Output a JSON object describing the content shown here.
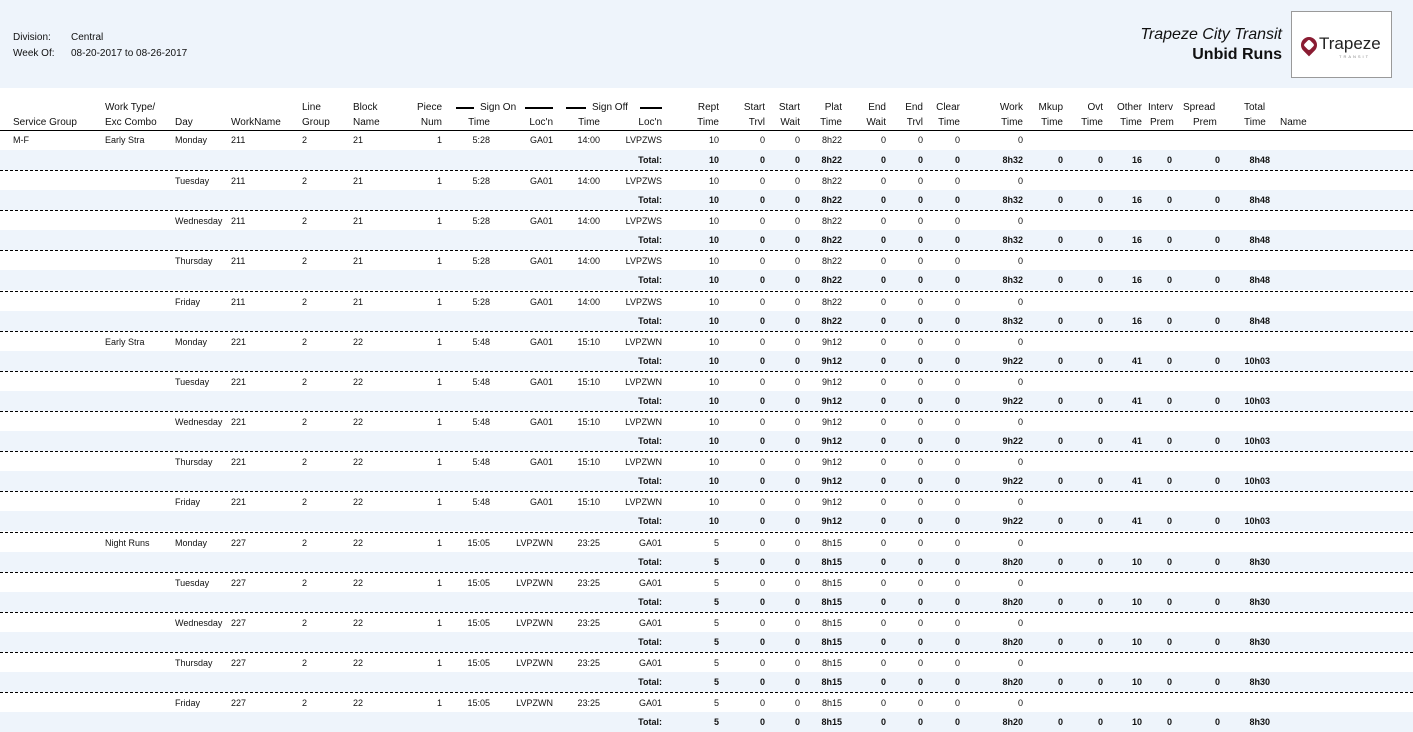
{
  "header": {
    "division_label": "Division:",
    "division_value": "Central",
    "week_label": "Week Of:",
    "week_value": "08-20-2017 to 08-26-2017",
    "company": "Trapeze City Transit",
    "report_title": "Unbid Runs",
    "logo_text": "Trapeze",
    "logo_sub": "TRANSIT"
  },
  "columns": {
    "service_group": "Service Group",
    "work_type_1": "Work Type/",
    "work_type_2": "Exc Combo",
    "day": "Day",
    "workname": "WorkName",
    "line_1": "Line",
    "line_2": "Group",
    "block_1": "Block",
    "block_2": "Name",
    "piece_1": "Piece",
    "piece_2": "Num",
    "sign_on": "Sign On",
    "sign_on_time": "Time",
    "sign_on_loc": "Loc'n",
    "sign_off": "Sign Off",
    "sign_off_time": "Time",
    "sign_off_loc": "Loc'n",
    "rept_1": "Rept",
    "rept_2": "Time",
    "start_trvl_1": "Start",
    "start_trvl_2": "Trvl",
    "start_wait_1": "Start",
    "start_wait_2": "Wait",
    "plat_1": "Plat",
    "plat_2": "Time",
    "end_wait_1": "End",
    "end_wait_2": "Wait",
    "end_trvl_1": "End",
    "end_trvl_2": "Trvl",
    "clear_1": "Clear",
    "clear_2": "Time",
    "work_1": "Work",
    "work_2": "Time",
    "mkup_1": "Mkup",
    "mkup_2": "Time",
    "ovt_1": "Ovt",
    "ovt_2": "Time",
    "other_1": "Other",
    "other_2": "Time",
    "interv_1": "Interv",
    "interv_2": "Prem",
    "spread_1": "Spread",
    "spread_2": "Prem",
    "total_1": "Total",
    "total_2": "Time",
    "name": "Name"
  },
  "rows": [
    {
      "sg": "M-F",
      "wt": "Early Stra",
      "day": "Monday",
      "wn": "211",
      "lg": "2",
      "bn": "21",
      "pn": "1",
      "on_t": "5:28",
      "on_l": "GA01",
      "off_t": "14:00",
      "off_l": "LVPZWS",
      "rept": "10",
      "st": "0",
      "sw": "0",
      "plat": "8h22",
      "ew": "0",
      "et": "0",
      "clr": "0",
      "work": "0",
      "tot": {
        "label": "Total:",
        "rept": "10",
        "st": "0",
        "sw": "0",
        "plat": "8h22",
        "ew": "0",
        "et": "0",
        "clr": "0",
        "work": "8h32",
        "mkup": "0",
        "ovt": "0",
        "other": "16",
        "interv": "0",
        "spread": "0",
        "total": "8h48"
      }
    },
    {
      "sg": "",
      "wt": "",
      "day": "Tuesday",
      "wn": "211",
      "lg": "2",
      "bn": "21",
      "pn": "1",
      "on_t": "5:28",
      "on_l": "GA01",
      "off_t": "14:00",
      "off_l": "LVPZWS",
      "rept": "10",
      "st": "0",
      "sw": "0",
      "plat": "8h22",
      "ew": "0",
      "et": "0",
      "clr": "0",
      "work": "0",
      "tot": {
        "label": "Total:",
        "rept": "10",
        "st": "0",
        "sw": "0",
        "plat": "8h22",
        "ew": "0",
        "et": "0",
        "clr": "0",
        "work": "8h32",
        "mkup": "0",
        "ovt": "0",
        "other": "16",
        "interv": "0",
        "spread": "0",
        "total": "8h48"
      }
    },
    {
      "sg": "",
      "wt": "",
      "day": "Wednesday",
      "wn": "211",
      "lg": "2",
      "bn": "21",
      "pn": "1",
      "on_t": "5:28",
      "on_l": "GA01",
      "off_t": "14:00",
      "off_l": "LVPZWS",
      "rept": "10",
      "st": "0",
      "sw": "0",
      "plat": "8h22",
      "ew": "0",
      "et": "0",
      "clr": "0",
      "work": "0",
      "tot": {
        "label": "Total:",
        "rept": "10",
        "st": "0",
        "sw": "0",
        "plat": "8h22",
        "ew": "0",
        "et": "0",
        "clr": "0",
        "work": "8h32",
        "mkup": "0",
        "ovt": "0",
        "other": "16",
        "interv": "0",
        "spread": "0",
        "total": "8h48"
      }
    },
    {
      "sg": "",
      "wt": "",
      "day": "Thursday",
      "wn": "211",
      "lg": "2",
      "bn": "21",
      "pn": "1",
      "on_t": "5:28",
      "on_l": "GA01",
      "off_t": "14:00",
      "off_l": "LVPZWS",
      "rept": "10",
      "st": "0",
      "sw": "0",
      "plat": "8h22",
      "ew": "0",
      "et": "0",
      "clr": "0",
      "work": "0",
      "tot": {
        "label": "Total:",
        "rept": "10",
        "st": "0",
        "sw": "0",
        "plat": "8h22",
        "ew": "0",
        "et": "0",
        "clr": "0",
        "work": "8h32",
        "mkup": "0",
        "ovt": "0",
        "other": "16",
        "interv": "0",
        "spread": "0",
        "total": "8h48"
      }
    },
    {
      "sg": "",
      "wt": "",
      "day": "Friday",
      "wn": "211",
      "lg": "2",
      "bn": "21",
      "pn": "1",
      "on_t": "5:28",
      "on_l": "GA01",
      "off_t": "14:00",
      "off_l": "LVPZWS",
      "rept": "10",
      "st": "0",
      "sw": "0",
      "plat": "8h22",
      "ew": "0",
      "et": "0",
      "clr": "0",
      "work": "0",
      "tot": {
        "label": "Total:",
        "rept": "10",
        "st": "0",
        "sw": "0",
        "plat": "8h22",
        "ew": "0",
        "et": "0",
        "clr": "0",
        "work": "8h32",
        "mkup": "0",
        "ovt": "0",
        "other": "16",
        "interv": "0",
        "spread": "0",
        "total": "8h48"
      }
    },
    {
      "sg": "",
      "wt": "Early Stra",
      "day": "Monday",
      "wn": "221",
      "lg": "2",
      "bn": "22",
      "pn": "1",
      "on_t": "5:48",
      "on_l": "GA01",
      "off_t": "15:10",
      "off_l": "LVPZWN",
      "rept": "10",
      "st": "0",
      "sw": "0",
      "plat": "9h12",
      "ew": "0",
      "et": "0",
      "clr": "0",
      "work": "0",
      "tot": {
        "label": "Total:",
        "rept": "10",
        "st": "0",
        "sw": "0",
        "plat": "9h12",
        "ew": "0",
        "et": "0",
        "clr": "0",
        "work": "9h22",
        "mkup": "0",
        "ovt": "0",
        "other": "41",
        "interv": "0",
        "spread": "0",
        "total": "10h03"
      }
    },
    {
      "sg": "",
      "wt": "",
      "day": "Tuesday",
      "wn": "221",
      "lg": "2",
      "bn": "22",
      "pn": "1",
      "on_t": "5:48",
      "on_l": "GA01",
      "off_t": "15:10",
      "off_l": "LVPZWN",
      "rept": "10",
      "st": "0",
      "sw": "0",
      "plat": "9h12",
      "ew": "0",
      "et": "0",
      "clr": "0",
      "work": "0",
      "tot": {
        "label": "Total:",
        "rept": "10",
        "st": "0",
        "sw": "0",
        "plat": "9h12",
        "ew": "0",
        "et": "0",
        "clr": "0",
        "work": "9h22",
        "mkup": "0",
        "ovt": "0",
        "other": "41",
        "interv": "0",
        "spread": "0",
        "total": "10h03"
      }
    },
    {
      "sg": "",
      "wt": "",
      "day": "Wednesday",
      "wn": "221",
      "lg": "2",
      "bn": "22",
      "pn": "1",
      "on_t": "5:48",
      "on_l": "GA01",
      "off_t": "15:10",
      "off_l": "LVPZWN",
      "rept": "10",
      "st": "0",
      "sw": "0",
      "plat": "9h12",
      "ew": "0",
      "et": "0",
      "clr": "0",
      "work": "0",
      "tot": {
        "label": "Total:",
        "rept": "10",
        "st": "0",
        "sw": "0",
        "plat": "9h12",
        "ew": "0",
        "et": "0",
        "clr": "0",
        "work": "9h22",
        "mkup": "0",
        "ovt": "0",
        "other": "41",
        "interv": "0",
        "spread": "0",
        "total": "10h03"
      }
    },
    {
      "sg": "",
      "wt": "",
      "day": "Thursday",
      "wn": "221",
      "lg": "2",
      "bn": "22",
      "pn": "1",
      "on_t": "5:48",
      "on_l": "GA01",
      "off_t": "15:10",
      "off_l": "LVPZWN",
      "rept": "10",
      "st": "0",
      "sw": "0",
      "plat": "9h12",
      "ew": "0",
      "et": "0",
      "clr": "0",
      "work": "0",
      "tot": {
        "label": "Total:",
        "rept": "10",
        "st": "0",
        "sw": "0",
        "plat": "9h12",
        "ew": "0",
        "et": "0",
        "clr": "0",
        "work": "9h22",
        "mkup": "0",
        "ovt": "0",
        "other": "41",
        "interv": "0",
        "spread": "0",
        "total": "10h03"
      }
    },
    {
      "sg": "",
      "wt": "",
      "day": "Friday",
      "wn": "221",
      "lg": "2",
      "bn": "22",
      "pn": "1",
      "on_t": "5:48",
      "on_l": "GA01",
      "off_t": "15:10",
      "off_l": "LVPZWN",
      "rept": "10",
      "st": "0",
      "sw": "0",
      "plat": "9h12",
      "ew": "0",
      "et": "0",
      "clr": "0",
      "work": "0",
      "tot": {
        "label": "Total:",
        "rept": "10",
        "st": "0",
        "sw": "0",
        "plat": "9h12",
        "ew": "0",
        "et": "0",
        "clr": "0",
        "work": "9h22",
        "mkup": "0",
        "ovt": "0",
        "other": "41",
        "interv": "0",
        "spread": "0",
        "total": "10h03"
      }
    },
    {
      "sg": "",
      "wt": "Night Runs",
      "day": "Monday",
      "wn": "227",
      "lg": "2",
      "bn": "22",
      "pn": "1",
      "on_t": "15:05",
      "on_l": "LVPZWN",
      "off_t": "23:25",
      "off_l": "GA01",
      "rept": "5",
      "st": "0",
      "sw": "0",
      "plat": "8h15",
      "ew": "0",
      "et": "0",
      "clr": "0",
      "work": "0",
      "tot": {
        "label": "Total:",
        "rept": "5",
        "st": "0",
        "sw": "0",
        "plat": "8h15",
        "ew": "0",
        "et": "0",
        "clr": "0",
        "work": "8h20",
        "mkup": "0",
        "ovt": "0",
        "other": "10",
        "interv": "0",
        "spread": "0",
        "total": "8h30"
      }
    },
    {
      "sg": "",
      "wt": "",
      "day": "Tuesday",
      "wn": "227",
      "lg": "2",
      "bn": "22",
      "pn": "1",
      "on_t": "15:05",
      "on_l": "LVPZWN",
      "off_t": "23:25",
      "off_l": "GA01",
      "rept": "5",
      "st": "0",
      "sw": "0",
      "plat": "8h15",
      "ew": "0",
      "et": "0",
      "clr": "0",
      "work": "0",
      "tot": {
        "label": "Total:",
        "rept": "5",
        "st": "0",
        "sw": "0",
        "plat": "8h15",
        "ew": "0",
        "et": "0",
        "clr": "0",
        "work": "8h20",
        "mkup": "0",
        "ovt": "0",
        "other": "10",
        "interv": "0",
        "spread": "0",
        "total": "8h30"
      }
    },
    {
      "sg": "",
      "wt": "",
      "day": "Wednesday",
      "wn": "227",
      "lg": "2",
      "bn": "22",
      "pn": "1",
      "on_t": "15:05",
      "on_l": "LVPZWN",
      "off_t": "23:25",
      "off_l": "GA01",
      "rept": "5",
      "st": "0",
      "sw": "0",
      "plat": "8h15",
      "ew": "0",
      "et": "0",
      "clr": "0",
      "work": "0",
      "tot": {
        "label": "Total:",
        "rept": "5",
        "st": "0",
        "sw": "0",
        "plat": "8h15",
        "ew": "0",
        "et": "0",
        "clr": "0",
        "work": "8h20",
        "mkup": "0",
        "ovt": "0",
        "other": "10",
        "interv": "0",
        "spread": "0",
        "total": "8h30"
      }
    },
    {
      "sg": "",
      "wt": "",
      "day": "Thursday",
      "wn": "227",
      "lg": "2",
      "bn": "22",
      "pn": "1",
      "on_t": "15:05",
      "on_l": "LVPZWN",
      "off_t": "23:25",
      "off_l": "GA01",
      "rept": "5",
      "st": "0",
      "sw": "0",
      "plat": "8h15",
      "ew": "0",
      "et": "0",
      "clr": "0",
      "work": "0",
      "tot": {
        "label": "Total:",
        "rept": "5",
        "st": "0",
        "sw": "0",
        "plat": "8h15",
        "ew": "0",
        "et": "0",
        "clr": "0",
        "work": "8h20",
        "mkup": "0",
        "ovt": "0",
        "other": "10",
        "interv": "0",
        "spread": "0",
        "total": "8h30"
      }
    },
    {
      "sg": "",
      "wt": "",
      "day": "Friday",
      "wn": "227",
      "lg": "2",
      "bn": "22",
      "pn": "1",
      "on_t": "15:05",
      "on_l": "LVPZWN",
      "off_t": "23:25",
      "off_l": "GA01",
      "rept": "5",
      "st": "0",
      "sw": "0",
      "plat": "8h15",
      "ew": "0",
      "et": "0",
      "clr": "0",
      "work": "0",
      "tot": {
        "label": "Total:",
        "rept": "5",
        "st": "0",
        "sw": "0",
        "plat": "8h15",
        "ew": "0",
        "et": "0",
        "clr": "0",
        "work": "8h20",
        "mkup": "0",
        "ovt": "0",
        "other": "10",
        "interv": "0",
        "spread": "0",
        "total": "8h30"
      }
    }
  ]
}
